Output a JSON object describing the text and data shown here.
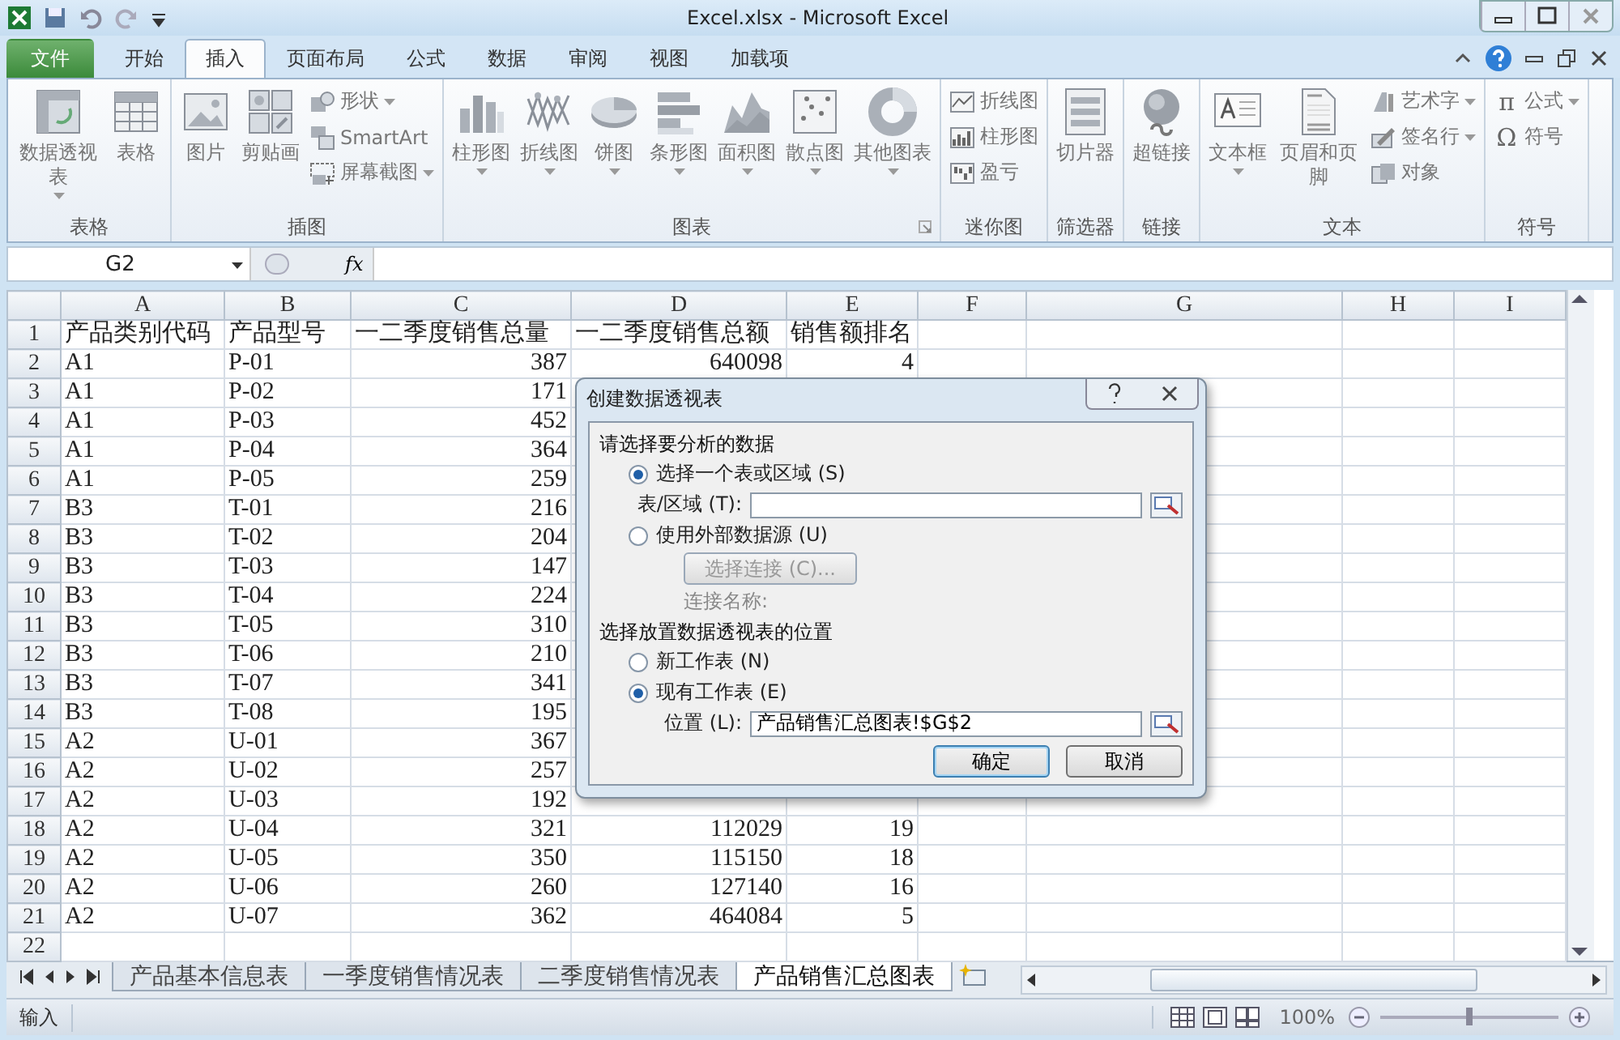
{
  "window": {
    "title": "Excel.xlsx  -  Microsoft Excel"
  },
  "ribbon_tabs": [
    {
      "label": "文件",
      "kind": "file",
      "selected": false
    },
    {
      "label": "开始",
      "kind": "tab",
      "selected": false
    },
    {
      "label": "插入",
      "kind": "tab",
      "selected": true
    },
    {
      "label": "页面布局",
      "kind": "tab",
      "selected": false
    },
    {
      "label": "公式",
      "kind": "tab",
      "selected": false
    },
    {
      "label": "数据",
      "kind": "tab",
      "selected": false
    },
    {
      "label": "审阅",
      "kind": "tab",
      "selected": false
    },
    {
      "label": "视图",
      "kind": "tab",
      "selected": false
    },
    {
      "label": "加载项",
      "kind": "tab",
      "selected": false
    }
  ],
  "ribbon_groups": [
    {
      "label": "表格",
      "launcher": false,
      "commands": [
        {
          "label": "数据透视表",
          "kind": "large",
          "dropdown": true
        },
        {
          "label": "表格",
          "kind": "large",
          "dropdown": false
        }
      ]
    },
    {
      "label": "插图",
      "launcher": false,
      "commands": [
        {
          "label": "图片",
          "kind": "large",
          "dropdown": false
        },
        {
          "label": "剪贴画",
          "kind": "large",
          "dropdown": false
        },
        {
          "label": "形状",
          "kind": "small",
          "dropdown": true
        },
        {
          "label": "SmartArt",
          "kind": "small",
          "dropdown": false
        },
        {
          "label": "屏幕截图",
          "kind": "small",
          "dropdown": true
        }
      ]
    },
    {
      "label": "图表",
      "launcher": true,
      "commands": [
        {
          "label": "柱形图",
          "kind": "large",
          "dropdown": true
        },
        {
          "label": "折线图",
          "kind": "large",
          "dropdown": true
        },
        {
          "label": "饼图",
          "kind": "large",
          "dropdown": true
        },
        {
          "label": "条形图",
          "kind": "large",
          "dropdown": true
        },
        {
          "label": "面积图",
          "kind": "large",
          "dropdown": true
        },
        {
          "label": "散点图",
          "kind": "large",
          "dropdown": true
        },
        {
          "label": "其他图表",
          "kind": "large",
          "dropdown": true
        }
      ]
    },
    {
      "label": "迷你图",
      "launcher": false,
      "commands": [
        {
          "label": "折线图",
          "kind": "small",
          "dropdown": false
        },
        {
          "label": "柱形图",
          "kind": "small",
          "dropdown": false
        },
        {
          "label": "盈亏",
          "kind": "small",
          "dropdown": false
        }
      ]
    },
    {
      "label": "筛选器",
      "launcher": false,
      "commands": [
        {
          "label": "切片器",
          "kind": "large",
          "dropdown": false
        }
      ]
    },
    {
      "label": "链接",
      "launcher": false,
      "commands": [
        {
          "label": "超链接",
          "kind": "large",
          "dropdown": false
        }
      ]
    },
    {
      "label": "文本",
      "launcher": false,
      "commands": [
        {
          "label": "文本框",
          "kind": "large",
          "dropdown": true
        },
        {
          "label": "页眉和页脚",
          "kind": "large",
          "dropdown": false
        },
        {
          "label": "艺术字",
          "kind": "small",
          "dropdown": true
        },
        {
          "label": "签名行",
          "kind": "small",
          "dropdown": true
        },
        {
          "label": "对象",
          "kind": "small",
          "dropdown": false
        }
      ]
    },
    {
      "label": "符号",
      "launcher": false,
      "commands": [
        {
          "label": "公式",
          "kind": "small",
          "dropdown": true,
          "glyph": "π"
        },
        {
          "label": "符号",
          "kind": "small",
          "dropdown": false,
          "glyph": "Ω"
        }
      ]
    }
  ],
  "formula_bar": {
    "name_box": "G2",
    "function_button": "fx"
  },
  "sheet": {
    "columns": [
      "A",
      "B",
      "C",
      "D",
      "E",
      "F",
      "G",
      "H",
      "I"
    ],
    "rows": [
      {
        "number": "1",
        "cells": [
          "产品类别代码",
          "产品型号",
          "一二季度销售总量",
          "一二季度销售总额",
          "销售额排名"
        ]
      },
      {
        "number": "2",
        "cells": [
          "A1",
          "P-01",
          "387",
          "640098",
          "4"
        ]
      },
      {
        "number": "3",
        "cells": [
          "A1",
          "P-02",
          "171"
        ]
      },
      {
        "number": "4",
        "cells": [
          "A1",
          "P-03",
          "452"
        ]
      },
      {
        "number": "5",
        "cells": [
          "A1",
          "P-04",
          "364"
        ]
      },
      {
        "number": "6",
        "cells": [
          "A1",
          "P-05",
          "259"
        ]
      },
      {
        "number": "7",
        "cells": [
          "B3",
          "T-01",
          "216"
        ]
      },
      {
        "number": "8",
        "cells": [
          "B3",
          "T-02",
          "204"
        ]
      },
      {
        "number": "9",
        "cells": [
          "B3",
          "T-03",
          "147"
        ]
      },
      {
        "number": "10",
        "cells": [
          "B3",
          "T-04",
          "224"
        ]
      },
      {
        "number": "11",
        "cells": [
          "B3",
          "T-05",
          "310"
        ]
      },
      {
        "number": "12",
        "cells": [
          "B3",
          "T-06",
          "210"
        ]
      },
      {
        "number": "13",
        "cells": [
          "B3",
          "T-07",
          "341"
        ]
      },
      {
        "number": "14",
        "cells": [
          "B3",
          "T-08",
          "195"
        ]
      },
      {
        "number": "15",
        "cells": [
          "A2",
          "U-01",
          "367"
        ]
      },
      {
        "number": "16",
        "cells": [
          "A2",
          "U-02",
          "257"
        ]
      },
      {
        "number": "17",
        "cells": [
          "A2",
          "U-03",
          "192"
        ]
      },
      {
        "number": "18",
        "cells": [
          "A2",
          "U-04",
          "321",
          "112029",
          "19"
        ]
      },
      {
        "number": "19",
        "cells": [
          "A2",
          "U-05",
          "350",
          "115150",
          "18"
        ]
      },
      {
        "number": "20",
        "cells": [
          "A2",
          "U-06",
          "260",
          "127140",
          "16"
        ]
      },
      {
        "number": "21",
        "cells": [
          "A2",
          "U-07",
          "362",
          "464084",
          "5"
        ]
      },
      {
        "number": "22",
        "cells": []
      }
    ]
  },
  "sheet_tabs": [
    {
      "label": "产品基本信息表",
      "selected": false
    },
    {
      "label": "一季度销售情况表",
      "selected": false
    },
    {
      "label": "二季度销售情况表",
      "selected": false
    },
    {
      "label": "产品销售汇总图表",
      "selected": true
    }
  ],
  "status_bar": {
    "mode": "输入",
    "zoom": "100%",
    "zoom_slider": {
      "level": 0.5
    }
  },
  "dialog": {
    "title": "创建数据透视表",
    "sections": [
      {
        "heading": "请选择要分析的数据",
        "items": [
          {
            "kind": "radio",
            "label": "选择一个表或区域 (S)",
            "selected": true
          },
          {
            "kind": "field",
            "label": "表/区域 (T):"
          },
          {
            "kind": "radio",
            "label": "使用外部数据源 (U)",
            "selected": false
          },
          {
            "kind": "button",
            "label": "选择连接 (C)...",
            "disabled": true
          },
          {
            "kind": "text",
            "label": "连接名称:",
            "disabled": true
          }
        ]
      },
      {
        "heading": "选择放置数据透视表的位置",
        "items": [
          {
            "kind": "radio",
            "label": "新工作表 (N)",
            "selected": false
          },
          {
            "kind": "radio",
            "label": "现有工作表 (E)",
            "selected": true
          },
          {
            "kind": "field",
            "label": "位置 (L):",
            "value": "产品销售汇总图表!$G$2"
          }
        ]
      }
    ],
    "buttons": [
      {
        "label": "确定",
        "default": true
      },
      {
        "label": "取消",
        "default": false
      }
    ]
  }
}
